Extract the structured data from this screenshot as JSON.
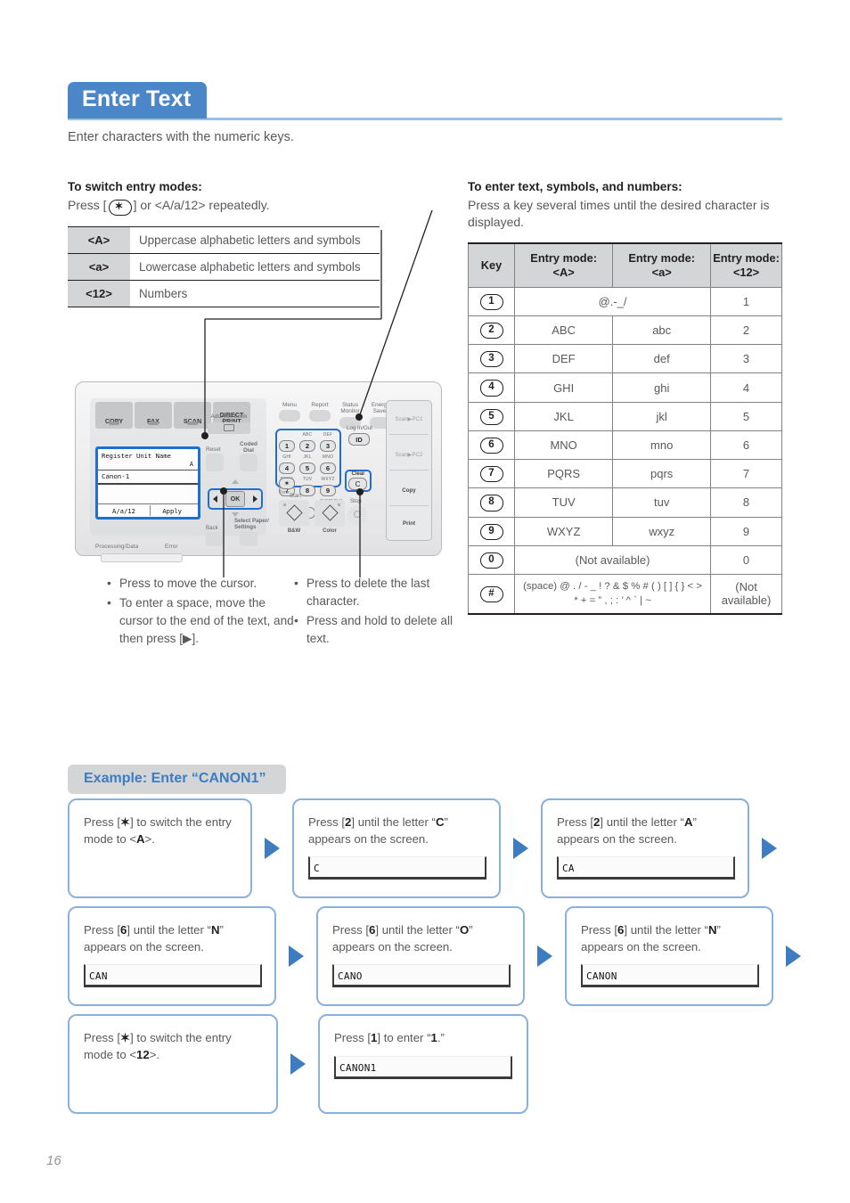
{
  "title": "Enter Text",
  "intro": "Enter characters with the numeric keys.",
  "page_number": "16",
  "left_section": {
    "heading": "To switch entry modes:",
    "subtext_prefix": "Press [",
    "subtext_key": "✶",
    "subtext_suffix": "] or <A/a/12> repeatedly.",
    "modes": [
      {
        "key": "<A>",
        "desc": "Uppercase alphabetic letters and symbols"
      },
      {
        "key": "<a>",
        "desc": "Lowercase alphabetic letters and symbols"
      },
      {
        "key": "<12>",
        "desc": "Numbers"
      }
    ]
  },
  "right_section": {
    "heading": "To enter text, symbols, and numbers:",
    "subtext": "Press a key several times until the desired character is displayed.",
    "headers": [
      "Key",
      "Entry mode: <A>",
      "Entry mode: <a>",
      "Entry mode: <12>"
    ],
    "header_lines": [
      {
        "l1": "Key",
        "l2": ""
      },
      {
        "l1": "Entry mode:",
        "l2": "<A>"
      },
      {
        "l1": "Entry mode:",
        "l2": "<a>"
      },
      {
        "l1": "Entry mode:",
        "l2": "<12>"
      }
    ],
    "rows": [
      {
        "key": "1",
        "upper": "@.-_/",
        "lower": "",
        "num": "1",
        "span": true
      },
      {
        "key": "2",
        "upper": "ABC",
        "lower": "abc",
        "num": "2",
        "span": false
      },
      {
        "key": "3",
        "upper": "DEF",
        "lower": "def",
        "num": "3",
        "span": false
      },
      {
        "key": "4",
        "upper": "GHI",
        "lower": "ghi",
        "num": "4",
        "span": false
      },
      {
        "key": "5",
        "upper": "JKL",
        "lower": "jkl",
        "num": "5",
        "span": false
      },
      {
        "key": "6",
        "upper": "MNO",
        "lower": "mno",
        "num": "6",
        "span": false
      },
      {
        "key": "7",
        "upper": "PQRS",
        "lower": "pqrs",
        "num": "7",
        "span": false
      },
      {
        "key": "8",
        "upper": "TUV",
        "lower": "tuv",
        "num": "8",
        "span": false
      },
      {
        "key": "9",
        "upper": "WXYZ",
        "lower": "wxyz",
        "num": "9",
        "span": false
      },
      {
        "key": "0",
        "upper": "(Not available)",
        "lower": "",
        "num": "0",
        "span": true
      },
      {
        "key": "#",
        "upper": "(space) @ . / - _ ! ? & $ % # ( ) [ ] { } < > * + = ” , ; : ’ ^ ` | ~",
        "lower": "",
        "num": "(Not available)",
        "span": true
      }
    ]
  },
  "device": {
    "mode_tabs": [
      "COPY",
      "FAX",
      "SCAN",
      "DIRECT PRINT"
    ],
    "lcd": {
      "title": "Register Unit Name",
      "mode_indicator": "A",
      "value": "Canon-1",
      "softkey_left": "A/a/12",
      "softkey_right": "Apply"
    },
    "address_book_label": "Address Book",
    "reset_label": "Reset",
    "coded_dial_label": "Coded Dial",
    "back_label": "Back",
    "select_paper_label": "Select Paper/ Settings",
    "ok_label": "OK",
    "top_buttons": [
      {
        "label": "Menu"
      },
      {
        "label": "Report"
      },
      {
        "label": "Status Monitor"
      },
      {
        "label": "Energy Saver"
      }
    ],
    "log_in_out_label": "Log In/Out",
    "id_label": "ID",
    "clear_label": "Clear",
    "clear_key": "C",
    "star_key": "✶",
    "tone_label": "Tone",
    "start_label": "Start",
    "start_bw": "B&W",
    "start_color": "Color",
    "stop_label": "Stop",
    "numpad": [
      {
        "num": "1",
        "letters": ""
      },
      {
        "num": "2",
        "letters": "ABC"
      },
      {
        "num": "3",
        "letters": "DEF"
      },
      {
        "num": "4",
        "letters": "GHI"
      },
      {
        "num": "5",
        "letters": "JKL"
      },
      {
        "num": "6",
        "letters": "MNO"
      },
      {
        "num": "7",
        "letters": "PQRS"
      },
      {
        "num": "8",
        "letters": "TUV"
      },
      {
        "num": "9",
        "letters": "WXYZ"
      },
      {
        "num": "0",
        "letters": ""
      },
      {
        "num": "#",
        "letters": "SYMBOLS"
      }
    ],
    "side_buttons": [
      "Scan▶PC1",
      "Scan▶PC2",
      "Copy",
      "Print"
    ],
    "status_labels": [
      "Processing/Data",
      "Error"
    ]
  },
  "notes_left": [
    "Press to move the cursor.",
    "To enter a space, move the cursor to the end of the text, and then press [▶]."
  ],
  "notes_right": [
    "Press to delete the last character.",
    "Press and hold to delete all text."
  ],
  "example": {
    "heading": "Example: Enter “CANON1”",
    "steps": [
      {
        "text_html": "Press [<b class=\"b\">✶</b>] to switch the entry mode to &lt;<b class=\"b\">A</b>&gt;.",
        "screen": null
      },
      {
        "text_html": "Press [<b class=\"b\">2</b>] until the letter “<b class=\"b\">C</b>” appears on the screen.",
        "screen": "C"
      },
      {
        "text_html": "Press [<b class=\"b\">2</b>] until the letter “<b class=\"b\">A</b>” appears on the screen.",
        "screen": "CA"
      },
      {
        "text_html": "Press [<b class=\"b\">6</b>] until the letter “<b class=\"b\">N</b>” appears on the screen.",
        "screen": "CAN"
      },
      {
        "text_html": "Press [<b class=\"b\">6</b>] until the letter “<b class=\"b\">O</b>” appears on the screen.",
        "screen": "CANO"
      },
      {
        "text_html": "Press [<b class=\"b\">6</b>] until the letter “<b class=\"b\">N</b>” appears on the screen.",
        "screen": "CANON"
      },
      {
        "text_html": "Press [<b class=\"b\">✶</b>] to switch the entry mode to &lt;<b class=\"b\">12</b>&gt;.",
        "screen": null
      },
      {
        "text_html": "Press [<b class=\"b\">1</b>] to enter “<b class=\"b\">1</b>.”",
        "screen": "CANON1"
      }
    ]
  },
  "colors": {
    "banner_blue": "#4a86c8",
    "accent_blue": "#3d7cc0",
    "box_border": "#8ab0dd",
    "header_grey": "#d4d5d7",
    "body_text": "#58595b",
    "highlight_blue": "#1f6fd0"
  }
}
